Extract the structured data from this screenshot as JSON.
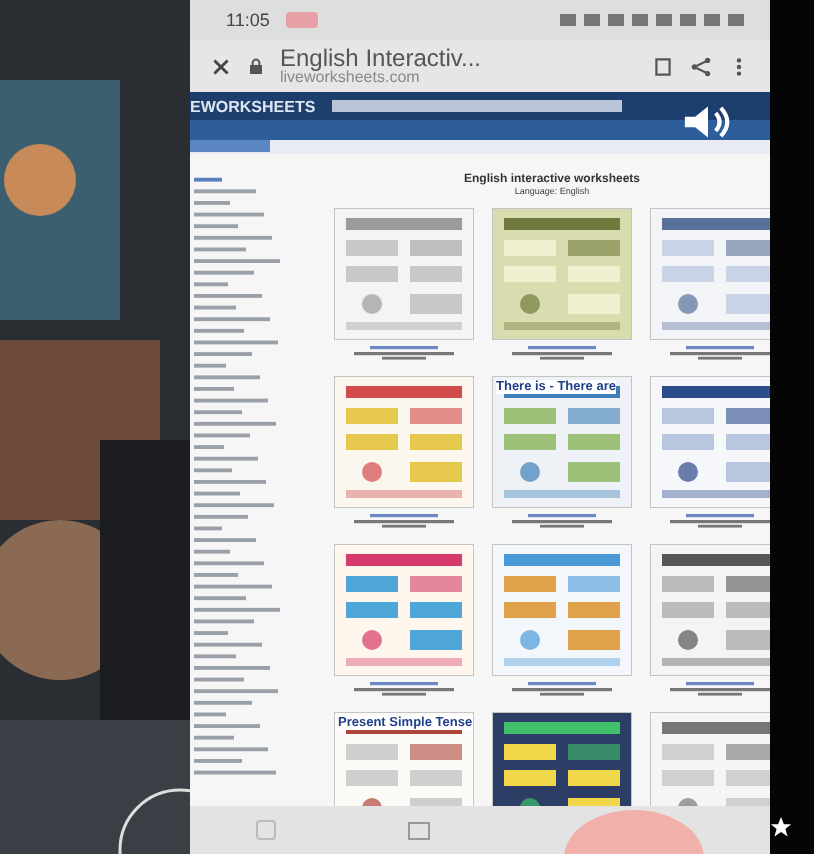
{
  "status_bar": {
    "time": "11:05"
  },
  "browser": {
    "title": "English Interactiv...",
    "url": "liveworksheets.com"
  },
  "site": {
    "logo": "EWORKSHEETS"
  },
  "page": {
    "heading": "English interactive worksheets",
    "subheading": "Language: English"
  },
  "worksheets": [
    {
      "kind": "picture"
    },
    {
      "kind": "picture"
    },
    {
      "kind": "picture"
    },
    {
      "kind": "picture"
    },
    {
      "kind": "picture",
      "title": "There is - There are"
    },
    {
      "kind": "picture"
    },
    {
      "kind": "picture"
    },
    {
      "kind": "picture"
    },
    {
      "kind": "picture"
    },
    {
      "kind": "picture",
      "title": "Present Simple Tense"
    },
    {
      "kind": "picture"
    },
    {
      "kind": "picture"
    }
  ]
}
